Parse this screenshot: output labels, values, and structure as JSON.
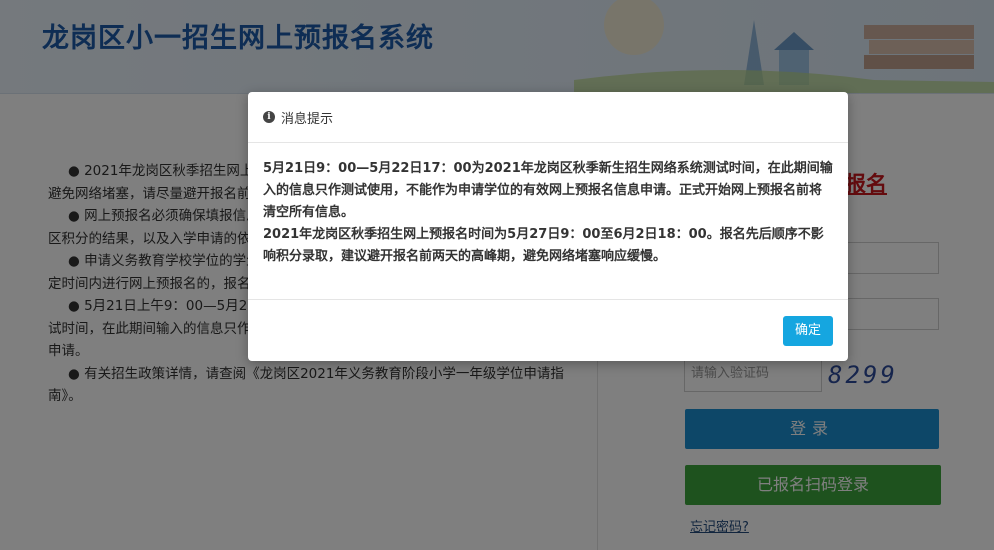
{
  "header": {
    "site_title": "龙岗区小一招生网上预报名系统"
  },
  "notice": {
    "paragraphs": [
      "● 2021年龙岗区秋季招生网上预报名时间为5月27日9：00至6月2日18：00。为避免网络堵塞，请尽量避开报名前两天的高峰期。",
      "● 网上预报名必须确保填报信息真实准确，所填信息将作为申请学位资格审核和学区积分的结果，以及入学申请的依据。",
      "● 申请义务教育学校学位的学生，需在规定时间内到所申请的学校递交材料。在规定时间内进行网上预报名的，报名先后不影响学位申请受理和录取。",
      "● 5月21日上午9：00—5月22日17：00为2021年龙岗区秋季新生招生网络系统测试时间，在此期间输入的信息只作测试使用，不能作为申请学位的有效网上预报名信息申请。",
      "● 有关招生政策详情，请查阅《龙岗区2021年义务教育阶段小学一年级学位申请指南》。"
    ]
  },
  "login": {
    "title": "报名",
    "id_placeholder": "号",
    "password_placeholder": "",
    "captcha_placeholder": "请输入验证码",
    "captcha_code": "8299",
    "login_button": "登录",
    "scan_button": "已报名扫码登录",
    "forgot_link": "忘记密码?"
  },
  "modal": {
    "title": "消息提示",
    "body_line1": "5月21日9：00—5月22日17：00为2021年龙岗区秋季新生招生网络系统测试时间，在此期间输入的信息只作测试使用，不能作为申请学位的有效网上预报名信息申请。正式开始网上预报名前将清空所有信息。",
    "body_line2": "2021年龙岗区秋季招生网上预报名时间为5月27日9：00至6月2日18：00。报名先后顺序不影响积分录取，建议避开报名前两天的高峰期，避免网络堵塞响应缓慢。",
    "confirm_label": "确定"
  },
  "colors": {
    "title_blue": "#1c5aa8",
    "login_blue": "#1a8fd0",
    "scan_green": "#3da43d",
    "confirm_blue": "#15a6e0",
    "accent_red": "#c8161d"
  }
}
